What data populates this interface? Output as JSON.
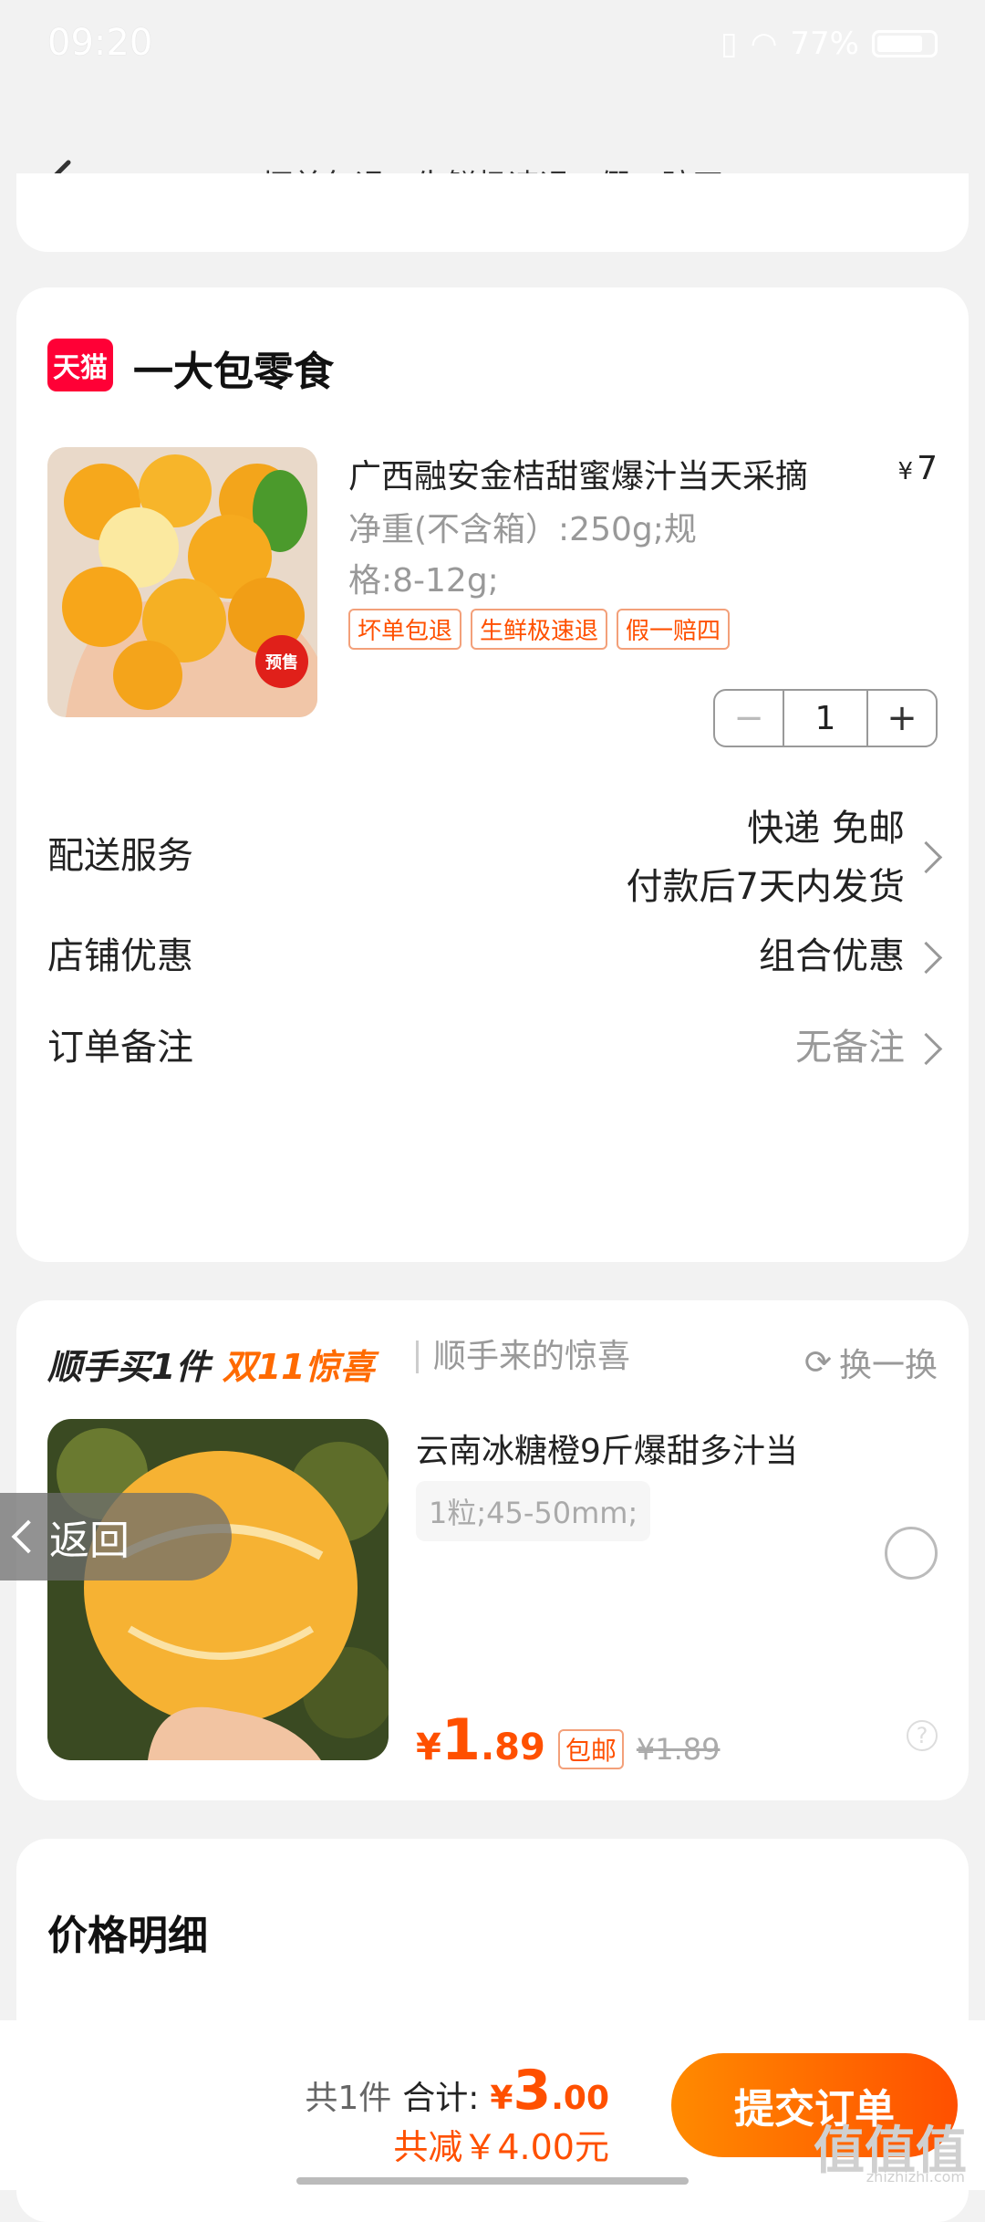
{
  "status_bar": {
    "time": "09:20",
    "battery": "77%"
  },
  "header": {
    "title": "坏单包退 · 生鲜极速退 · 假一赔四"
  },
  "store": {
    "logo_text": "天猫",
    "name": "一大包零食"
  },
  "product": {
    "title": "广西融安金桔甜蜜爆汁当天采摘",
    "price_currency": "¥",
    "price": "7",
    "spec": "净重(不含箱）:250g;规格:8-12g;",
    "presale_badge": "预售",
    "tags": [
      "坏单包退",
      "生鲜极速退",
      "假一赔四"
    ],
    "quantity": "1"
  },
  "rows": {
    "delivery": {
      "label": "配送服务",
      "value_line1": "快递 免邮",
      "value_line2": "付款后7天内发货"
    },
    "discount": {
      "label": "店铺优惠",
      "value": "组合优惠"
    },
    "note": {
      "label": "订单备注",
      "value": "无备注"
    }
  },
  "recommend": {
    "title_prefix": "顺手买1件",
    "title_highlight": "双11惊喜",
    "subtitle": "顺手来的惊喜",
    "swap_label": "换一换",
    "name": "云南冰糖橙9斤爆甜多汁当",
    "spec": "1粒;45-50mm;",
    "price_symbol": "¥",
    "price_int": "1",
    "price_dec": ".89",
    "ship_tag": "包邮",
    "orig_price": "¥1.89"
  },
  "return_float": {
    "label": "返回"
  },
  "price_detail": {
    "title": "价格明细"
  },
  "bottom": {
    "count": "共1件",
    "total_label": "合计:",
    "total_symbol": "¥",
    "total_int": "3",
    "total_dec": ".00",
    "saved": "共减￥4.00元",
    "submit": "提交订单"
  },
  "watermark": {
    "text": "值值值",
    "sub": "zhizhizhi.com"
  },
  "colors": {
    "accent": "#ff5000",
    "tmall": "#ff0036"
  }
}
